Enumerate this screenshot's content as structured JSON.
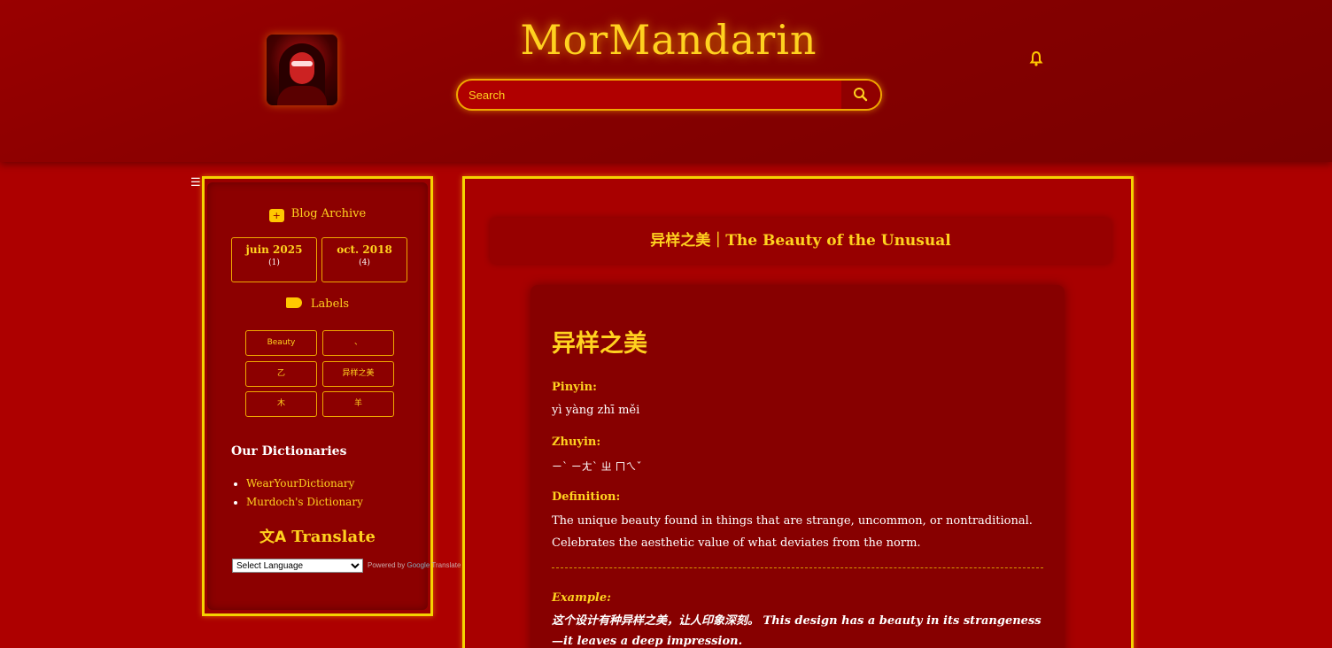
{
  "header": {
    "site_title": "MorMandarin",
    "search_placeholder": "Search"
  },
  "sidebar": {
    "menu_icon": "☰",
    "archive_heading": "Blog Archive",
    "archive": [
      {
        "month": "juin 2025",
        "count": "(1)"
      },
      {
        "month": "oct. 2018",
        "count": "(4)"
      }
    ],
    "labels_heading": "Labels",
    "labels": [
      "Beauty",
      "、",
      "乙",
      "异样之美",
      "木",
      "羊"
    ],
    "dictionaries_heading": "Our Dictionaries",
    "dictionaries": [
      "WearYourDictionary",
      "Murdoch's Dictionary"
    ],
    "translate_heading": "Translate",
    "language_select": "Select Language",
    "powered_by": "Powered by",
    "powered_google": "Google",
    "powered_translate": "Translate"
  },
  "post": {
    "title": "异样之美｜The Beauty of the Unusual",
    "heading": "异样之美",
    "pinyin_label": "Pinyin:",
    "pinyin": "yì yàng zhī měi",
    "zhuyin_label": "Zhuyin:",
    "zhuyin": "ㄧˋ ㄧㄤˋ ㄓ ㄇㄟˇ",
    "definition_label": "Definition:",
    "definition": "The unique beauty found in things that are strange, uncommon, or nontraditional. Celebrates the aesthetic value of what deviates from the norm.",
    "example_label": "Example:",
    "example": "这个设计有种异样之美，让人印象深刻。 This design has a beauty in its strangeness—it leaves a deep impression."
  },
  "colors": {
    "background": "#ad0000",
    "header": "#850000",
    "accent_gold": "#ffd21f",
    "border_yellow": "#f5d300"
  },
  "icons": [
    "search-icon",
    "bell-icon",
    "menu-icon",
    "archive-icon",
    "label-icon",
    "translate-icon"
  ]
}
